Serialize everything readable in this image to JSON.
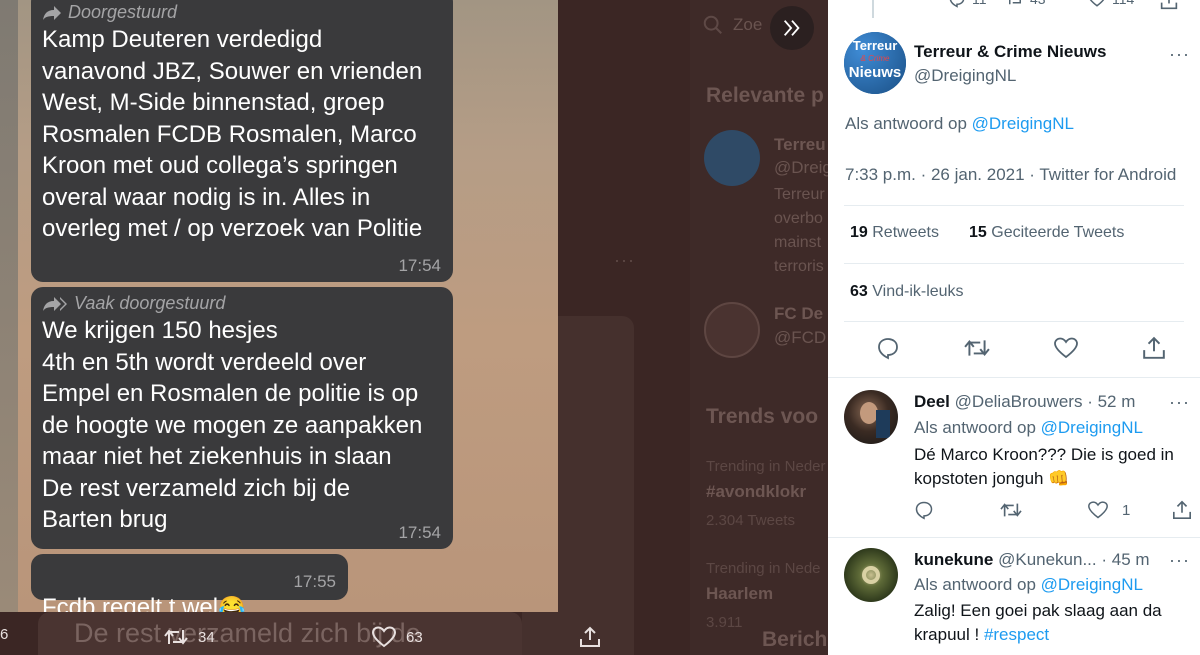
{
  "background": {
    "search_placeholder": "Zoe",
    "relevant_heading": "Relevante p",
    "account1_name": "Terreu",
    "account1_handle": "@Dreig",
    "account1_bio": [
      "Terreur",
      "overbo",
      "mainst",
      "terroris"
    ],
    "account2_name": "FC De",
    "account2_handle": "@FCD",
    "trends_heading": "Trends voo",
    "trend1_context": "Trending in Neder",
    "trend1_name": "#avondklokr",
    "trend1_count": "2.304 Tweets",
    "trend2_context": "Trending in Nede",
    "trend2_name": "Haarlem",
    "trend2_count": "3.911",
    "messages_label": "Berich",
    "echo_text": "De rest verzameld zich bij de"
  },
  "media": {
    "messages": [
      {
        "forward_label": "Doorgestuurd",
        "text": "Kamp Deuteren verdedigd\nvanavond JBZ, Souwer en vrienden\nWest, M-Side binnenstad, groep\nRosmalen FCDB Rosmalen, Marco\nKroon met oud collega’s springen\noveral waar nodig is in. Alles in\noverleg met / op verzoek van Politie",
        "time": "17:54"
      },
      {
        "forward_label": "Vaak doorgestuurd",
        "text": "We krijgen 150 hesjes\n4th en 5th wordt verdeeld over\nEmpel en Rosmalen de politie is op\nde hoogte we mogen ze aanpakken\nmaar niet het ziekenhuis in slaan\nDe rest verzameld zich bij de\nBarten brug",
        "time": "17:54"
      },
      {
        "text": "Fcdb regelt t wel",
        "emoji": "😂",
        "time": "17:55"
      }
    ]
  },
  "media_actions": {
    "reply_count_partial": "6",
    "retweet_count": "34",
    "like_count": "63"
  },
  "panel": {
    "top_stats": {
      "replies": "11",
      "retweets": "43",
      "likes": "114"
    },
    "tweet": {
      "author_name": "Terreur & Crime Nieuws",
      "author_handle": "@DreigingNL",
      "avatar_text_line1": "Terreur",
      "avatar_text_line2": "& Crime",
      "avatar_text_line3": "Nieuws",
      "reply_to_prefix": "Als antwoord op",
      "reply_to_handle": "@DreigingNL",
      "timestamp": "7:33 p.m. · 26 jan. 2021 · Twitter for Android",
      "retweets_count": "19",
      "retweets_label": "Retweets",
      "quotes_count": "15",
      "quotes_label": "Geciteerde Tweets",
      "likes_count": "63",
      "likes_label": "Vind-ik-leuks"
    },
    "replies": [
      {
        "name": "Deel",
        "handle": "@DeliaBrouwers",
        "age": "· 52 m",
        "reply_to_prefix": "Als antwoord op",
        "reply_to_handle": "@DreigingNL",
        "text": "Dé Marco Kroon??? Die is goed in kopstoten jonguh",
        "emoji": "👊",
        "like_count": "1"
      },
      {
        "name": "kunekune",
        "handle": "@Kunekun...",
        "age": "· 45 m",
        "reply_to_prefix": "Als antwoord op",
        "reply_to_handle": "@DreigingNL",
        "text": "Zalig! Een goei pak slaag aan da krapuul !",
        "hashtag": "#respect"
      }
    ]
  },
  "colors": {
    "accent": "#1d9bf0",
    "text": "#0f1419",
    "secondary": "#536471",
    "bubble": "#3a3a3c",
    "overlay": "#3b2624"
  }
}
